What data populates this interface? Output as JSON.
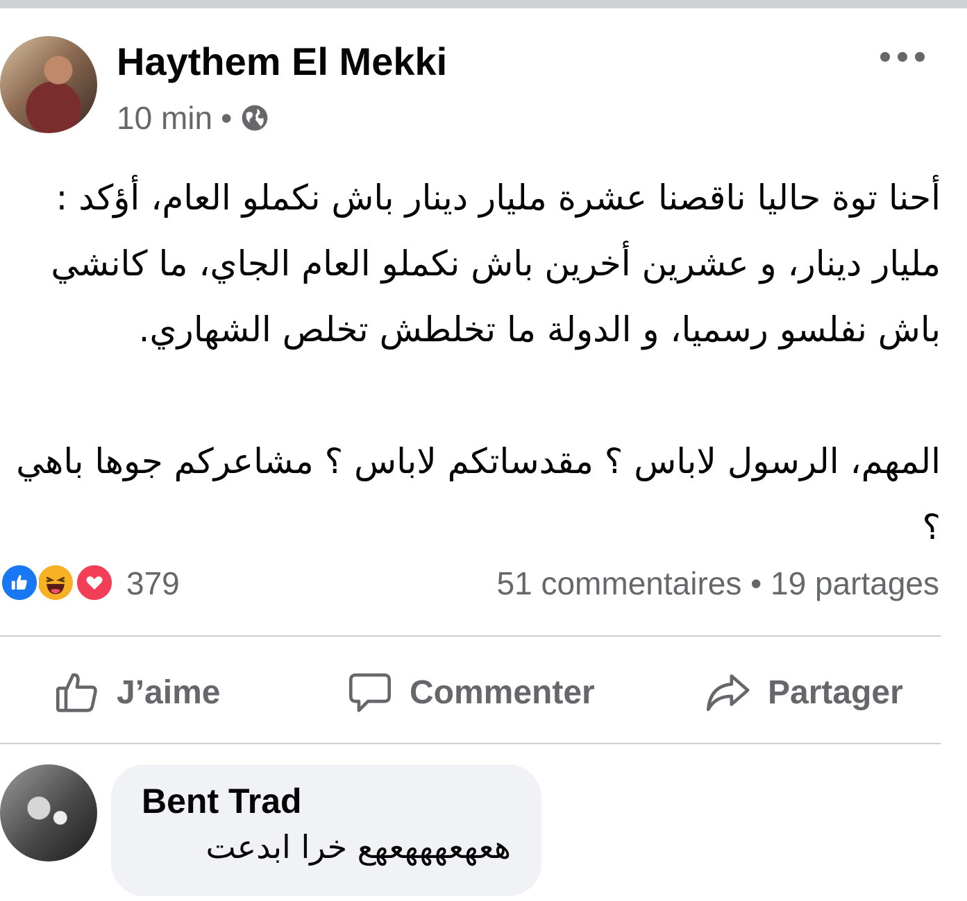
{
  "post": {
    "author_name": "Haythem El Mekki",
    "timestamp": "10 min",
    "separator": "•",
    "privacy_icon": "globe-icon",
    "menu_icon": "more-dots-icon",
    "body": {
      "paragraph1": "أحنا توة حاليا ناقصنا عشرة مليار دينار باش نكملو العام، أؤكد : مليار دينار، و عشرين أخرين باش نكملو العام الجاي، ما كانشي باش نفلسو رسميا، و الدولة ما تخلطش تخلص الشهاري.",
      "paragraph2": "المهم، الرسول لاباس ؟ مقدساتكم لاباس ؟ مشاعركم جوها باهي ؟"
    }
  },
  "reactions": {
    "icons": [
      "like-icon",
      "haha-icon",
      "love-icon"
    ],
    "count": "379",
    "comments": "51 commentaires",
    "dot": "•",
    "shares": "19 partages"
  },
  "actions": {
    "like_label": "J’aime",
    "comment_label": "Commenter",
    "share_label": "Partager"
  },
  "comment": {
    "author_name": "Bent Trad",
    "text": "هعهعهههعهع خرا ابدعت"
  },
  "colors": {
    "text_primary": "#050505",
    "text_secondary": "#65676b",
    "divider": "#ced0d4",
    "bubble": "#f0f2f5",
    "like_blue": "#1877f2",
    "haha_yellow": "#f7b125",
    "love_red": "#f33e58"
  }
}
